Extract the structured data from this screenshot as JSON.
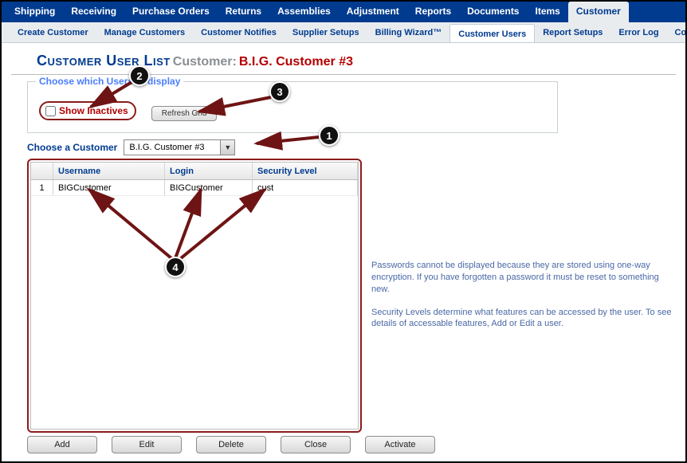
{
  "topnav": {
    "tabs": [
      "Shipping",
      "Receiving",
      "Purchase Orders",
      "Returns",
      "Assemblies",
      "Adjustment",
      "Reports",
      "Documents",
      "Items",
      "Customer"
    ],
    "active": "Customer"
  },
  "subnav": {
    "items": [
      "Create Customer",
      "Manage Customers",
      "Customer Notifies",
      "Supplier Setups",
      "Billing Wizard™",
      "Customer Users",
      "Report Setups",
      "Error Log",
      "Connecti"
    ],
    "active": "Customer Users"
  },
  "title": {
    "main": "Customer User List",
    "sublabel": "Customer:",
    "customer": "B.I.G. Customer #3"
  },
  "choose_box": {
    "legend": "Choose which Users to display",
    "show_inactives_label": "Show Inactives",
    "refresh_label": "Refresh Grid"
  },
  "choose_customer": {
    "label": "Choose a Customer",
    "value": "B.I.G. Customer #3"
  },
  "grid": {
    "headers": {
      "num": "",
      "username": "Username",
      "login": "Login",
      "security": "Security Level"
    },
    "rows": [
      {
        "num": "1",
        "username": "BIGCustomer",
        "login": "BIGCustomer",
        "security": "cust"
      }
    ]
  },
  "info": {
    "p1": "Passwords cannot be displayed because they are stored using one-way encryption. If you have forgotten a password it must be reset to something new.",
    "p2": "Security Levels determine what features can be accessed by the user. To see details of accessable features, Add or Edit a user."
  },
  "buttons": {
    "add": "Add",
    "edit": "Edit",
    "delete": "Delete",
    "close": "Close",
    "activate": "Activate"
  },
  "annotations": {
    "b1": "1",
    "b2": "2",
    "b3": "3",
    "b4": "4"
  }
}
